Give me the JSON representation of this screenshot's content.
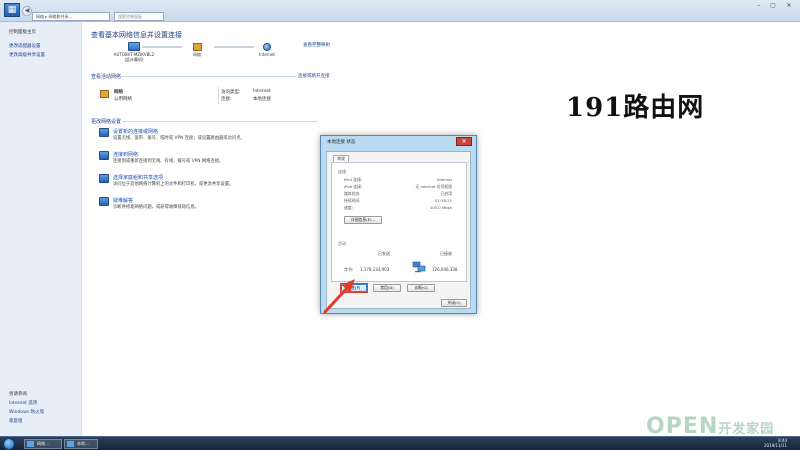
{
  "window": {
    "address": "网络 ▸ 网络和共享…",
    "search_placeholder": "搜索控制面板",
    "btn_min": "–",
    "btn_max": "▢",
    "btn_close": "✕",
    "back": "◀",
    "forward": "▶"
  },
  "sidebar": {
    "items": [
      {
        "label": "控制面板主页"
      },
      {
        "label": "更改适配器设置"
      },
      {
        "label": "更改高级共享设置"
      }
    ],
    "see_also": [
      {
        "label": "另请参阅"
      },
      {
        "label": "Internet 选项"
      },
      {
        "label": "Windows 防火墙"
      },
      {
        "label": "家庭组"
      }
    ]
  },
  "main": {
    "title": "查看基本网络信息并设置连接",
    "full_map_link": "查看完整映射",
    "map": [
      {
        "label": "AUTOBVT-MZIKVBL2",
        "sub": "(此计算机)"
      },
      {
        "label": "网络",
        "sub": ""
      },
      {
        "label": "Internet",
        "sub": ""
      }
    ],
    "active_title": "查看活动网络",
    "connect_link": "连接或断开连接",
    "network_name": "网络",
    "network_type": "公用网络",
    "access_type_label": "访问类型:",
    "access_type_value": "Internet",
    "connections_label": "连接:",
    "connections_value": "本地连接",
    "change_title": "更改网络设置",
    "tasks": [
      {
        "title": "设置新的连接或网络",
        "desc": "设置无线、宽带、拨号、临时或 VPN 连接；或设置路由器或访问点。"
      },
      {
        "title": "连接到网络",
        "desc": "连接到或重新连接到无线、有线、拨号或 VPN 网络连接。"
      },
      {
        "title": "选择家庭组和共享选项",
        "desc": "访问位于其他网络计算机上的文件和打印机，或更改共享设置。"
      },
      {
        "title": "疑难解答",
        "desc": "诊断并修复网络问题，或获得故障排除信息。"
      }
    ]
  },
  "watermark": {
    "site": "191路由网",
    "brand_main": "OPEN",
    "brand_sub": "开发家园"
  },
  "dialog": {
    "title": "本地连接 状态",
    "close": "✕",
    "tab": "常规",
    "group_connection": "连接",
    "rows": [
      {
        "label": "IPv4 连接:",
        "value": "Internet"
      },
      {
        "label": "IPv6 连接:",
        "value": "无 Internet 访问权限"
      },
      {
        "label": "媒体状态:",
        "value": "已启用"
      },
      {
        "label": "持续时间:",
        "value": "01:38:21"
      },
      {
        "label": "速度:",
        "value": "100.0 Mbps"
      }
    ],
    "details_btn": "详细信息(E)...",
    "group_activity": "活动",
    "sent_label": "已发送",
    "received_label": "已接收",
    "bytes_label": "字节:",
    "bytes_sent": "1,178,234,903",
    "bytes_received": "126,946,338",
    "properties_btn": "属性(P)",
    "disable_btn": "禁用(D)",
    "diagnose_btn": "诊断(G)",
    "close_btn": "关闭(C)"
  },
  "taskbar": {
    "items": [
      {
        "label": "网络…"
      },
      {
        "label": "本地…"
      }
    ],
    "time": "8:44",
    "date": "2019/11/11"
  }
}
